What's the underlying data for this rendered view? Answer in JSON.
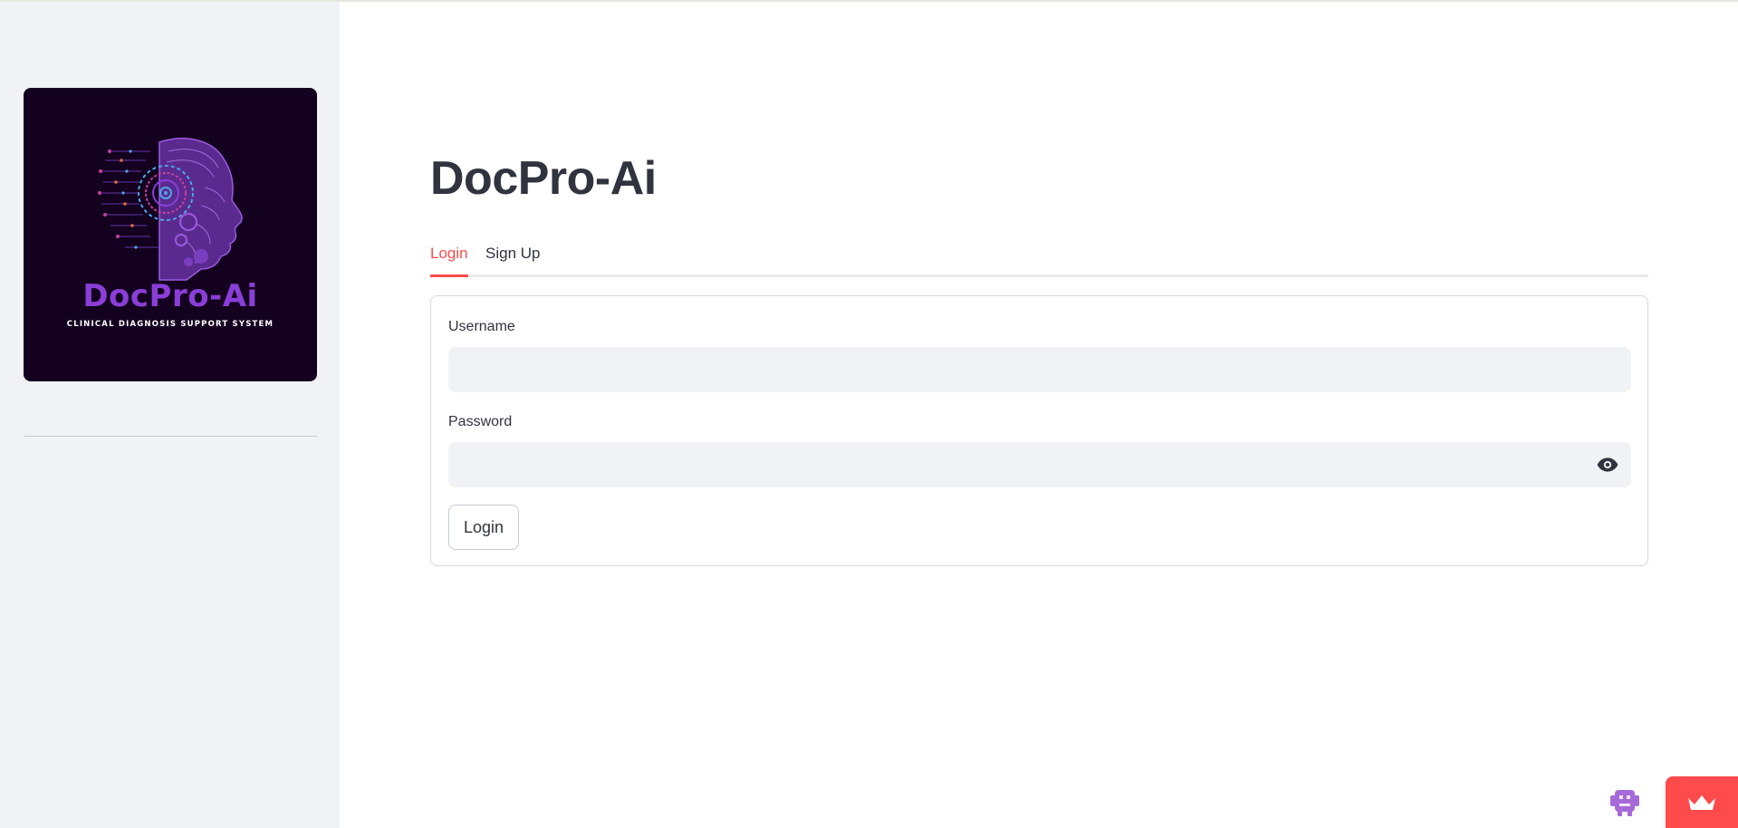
{
  "sidebar": {
    "logo": {
      "title": "DocPro-Ai",
      "subtitle": "CLINICAL DIAGNOSIS SUPPORT SYSTEM"
    }
  },
  "main": {
    "title": "DocPro-Ai",
    "tabs": [
      {
        "label": "Login",
        "active": true
      },
      {
        "label": "Sign Up",
        "active": false
      }
    ],
    "form": {
      "username_label": "Username",
      "username_value": "",
      "password_label": "Password",
      "password_value": "",
      "submit_label": "Login"
    }
  },
  "icons": {
    "password_toggle": "eye-icon",
    "floating_app": "bug-icon",
    "deploy_badge": "crown-icon"
  },
  "colors": {
    "accent": "#ff4b4b",
    "sidebar_bg": "#f0f2f6",
    "text": "#31333f",
    "logo_bg": "#14001f",
    "logo_purple": "#8a3ed8"
  }
}
